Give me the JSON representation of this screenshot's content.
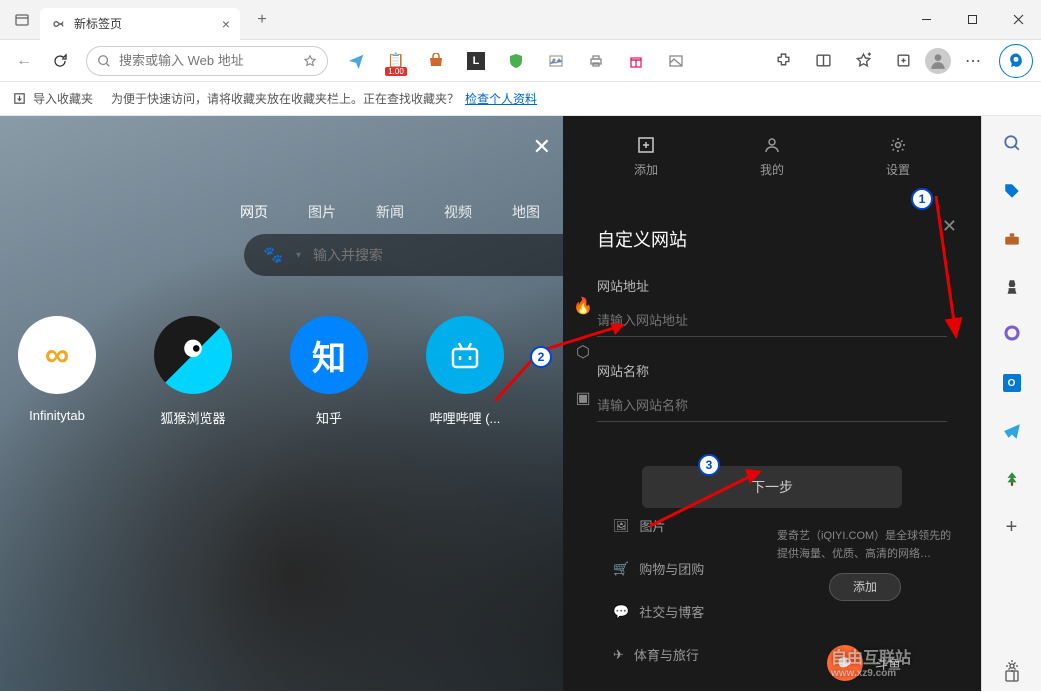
{
  "window": {
    "tab_title": "新标签页"
  },
  "toolbar": {
    "address_placeholder": "搜索或输入 Web 地址",
    "badge_100": "1.00"
  },
  "fav_bar": {
    "import_label": "导入收藏夹",
    "hint_text": "为便于快速访问，请将收藏夹放在收藏夹栏上。正在查找收藏夹？",
    "link_text": "检查个人资料"
  },
  "main": {
    "nav_tabs": [
      "网页",
      "图片",
      "新闻",
      "视频",
      "地图"
    ],
    "search_placeholder": "输入并搜索",
    "tiles": [
      {
        "label": "Infinitytab"
      },
      {
        "label": "狐猴浏览器"
      },
      {
        "label": "知乎"
      },
      {
        "label": "哔哩哔哩 (..."
      }
    ]
  },
  "panel": {
    "tabs": {
      "add": "添加",
      "mine": "我的",
      "settings": "设置"
    },
    "title": "自定义网站",
    "url_label": "网站地址",
    "url_placeholder": "请输入网站地址",
    "name_label": "网站名称",
    "name_placeholder": "请输入网站名称",
    "next_button": "下一步",
    "categories": {
      "image": "图片",
      "shopping": "购物与团购",
      "social": "社交与博客",
      "sports": "体育与旅行"
    },
    "card_text": "爱奇艺（iQIYI.COM）是全球领先的提供海量、优质、高清的网络…",
    "card_button": "添加",
    "douyu": "斗鱼"
  },
  "watermark": {
    "main": "自由互联站",
    "sub": "www.xz9.com"
  }
}
